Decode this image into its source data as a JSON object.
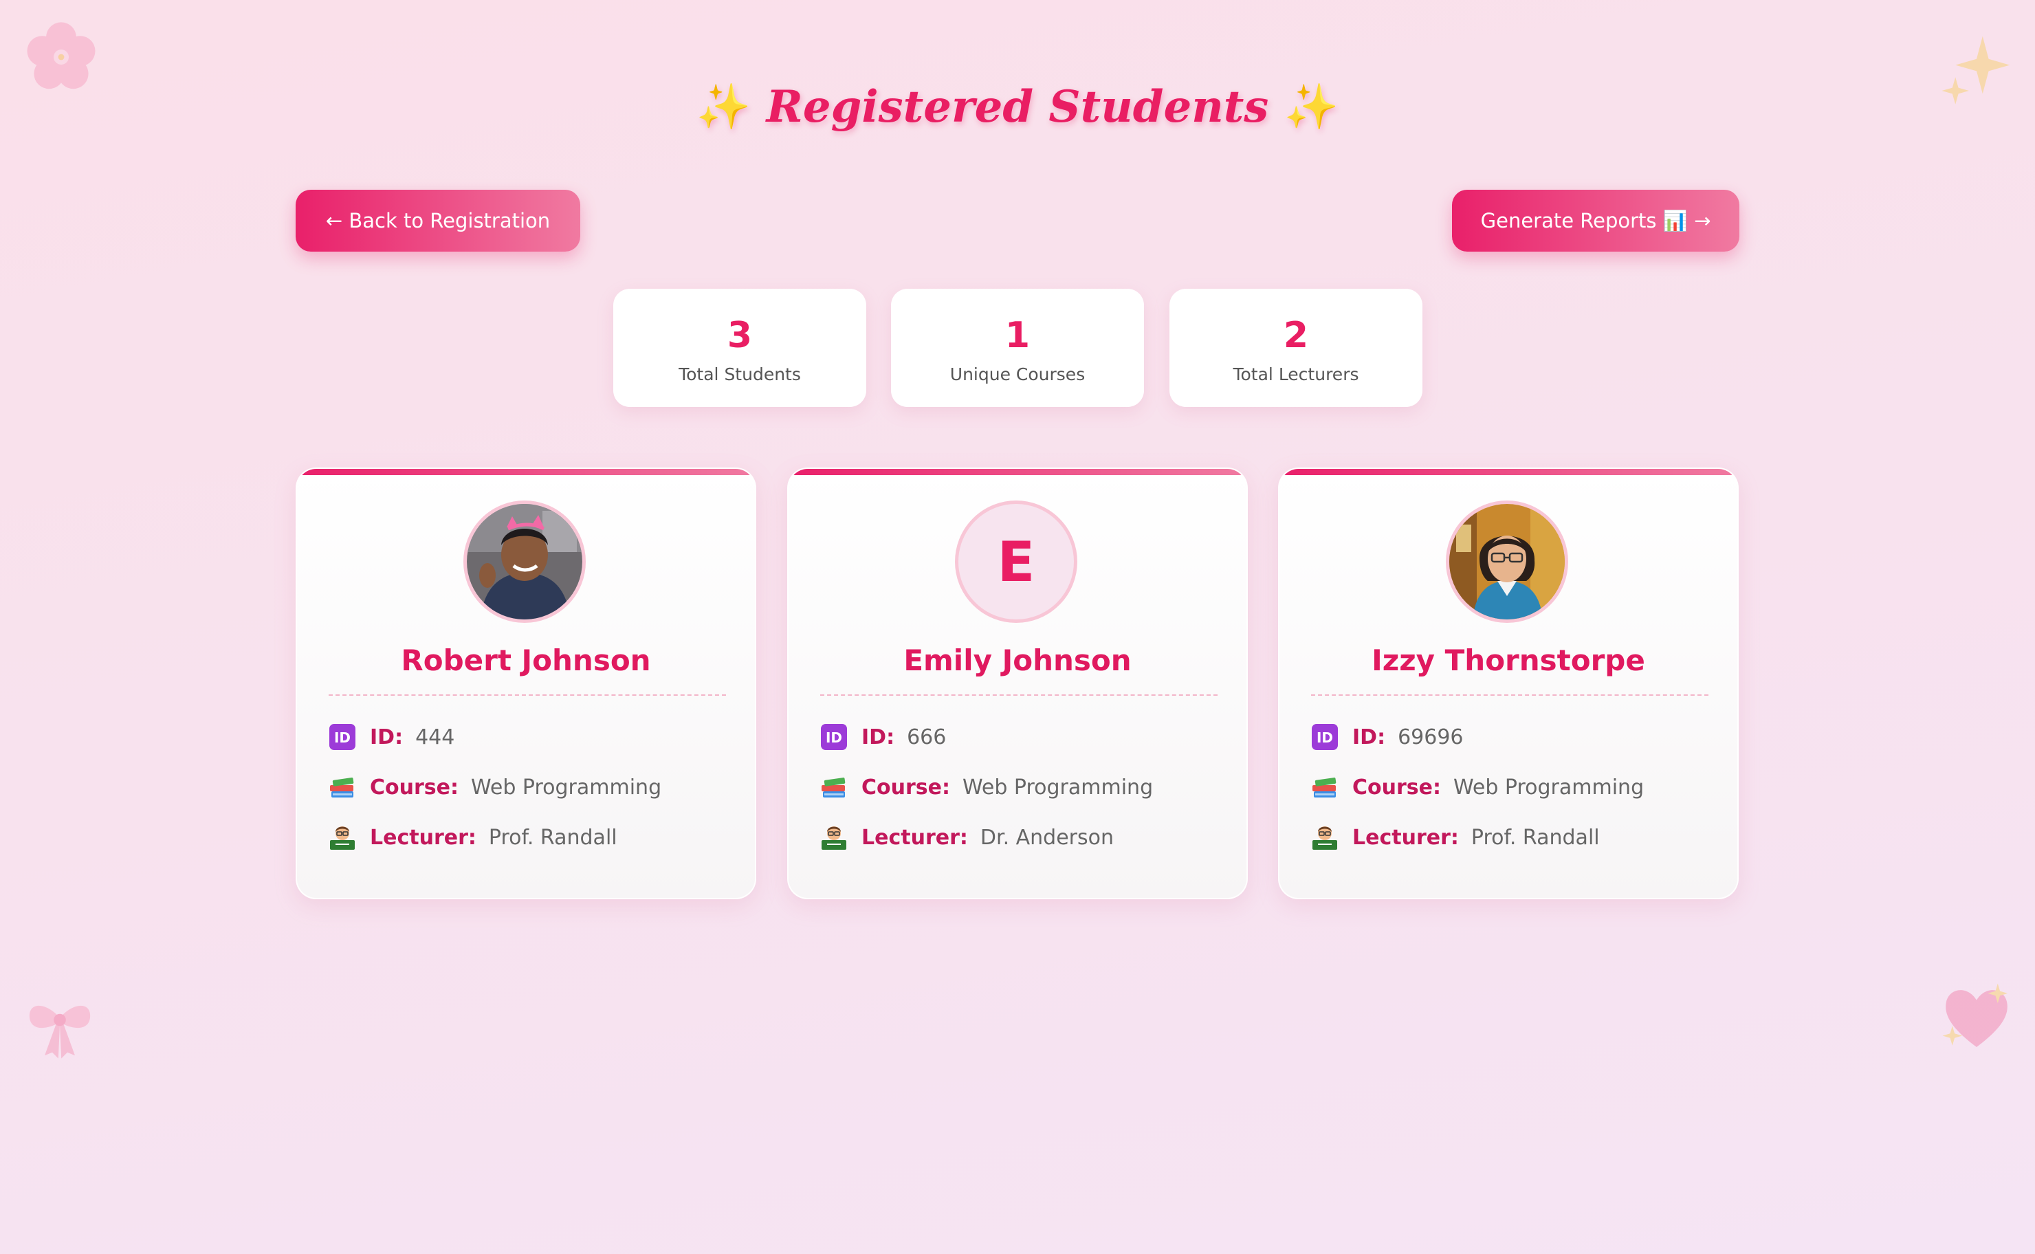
{
  "header": {
    "title": "Registered Students",
    "sparkle_left": "✨",
    "sparkle_right": "✨"
  },
  "toolbar": {
    "back_label": "← Back to Registration",
    "reports_label": "Generate Reports 📊 →"
  },
  "stats": [
    {
      "value": "3",
      "label": "Total Students"
    },
    {
      "value": "1",
      "label": "Unique Courses"
    },
    {
      "value": "2",
      "label": "Total Lecturers"
    }
  ],
  "field_labels": {
    "id": "ID:",
    "course": "Course:",
    "lecturer": "Lecturer:"
  },
  "students": [
    {
      "name": "Robert Johnson",
      "id": "444",
      "course": "Web Programming",
      "lecturer": "Prof. Randall",
      "avatar": "photo"
    },
    {
      "name": "Emily Johnson",
      "id": "666",
      "course": "Web Programming",
      "lecturer": "Dr. Anderson",
      "avatar": "letter",
      "initial": "E"
    },
    {
      "name": "Izzy Thornstorpe",
      "id": "69696",
      "course": "Web Programming",
      "lecturer": "Prof. Randall",
      "avatar": "photo"
    }
  ],
  "colors": {
    "accent": "#e91e63",
    "label": "#c2185b",
    "background": "#fae0ea"
  },
  "icons": [
    "cherry-blossom-icon",
    "sparkles-icon",
    "ribbon-icon",
    "sparkling-heart-icon",
    "id-icon",
    "books-icon",
    "teacher-icon"
  ]
}
